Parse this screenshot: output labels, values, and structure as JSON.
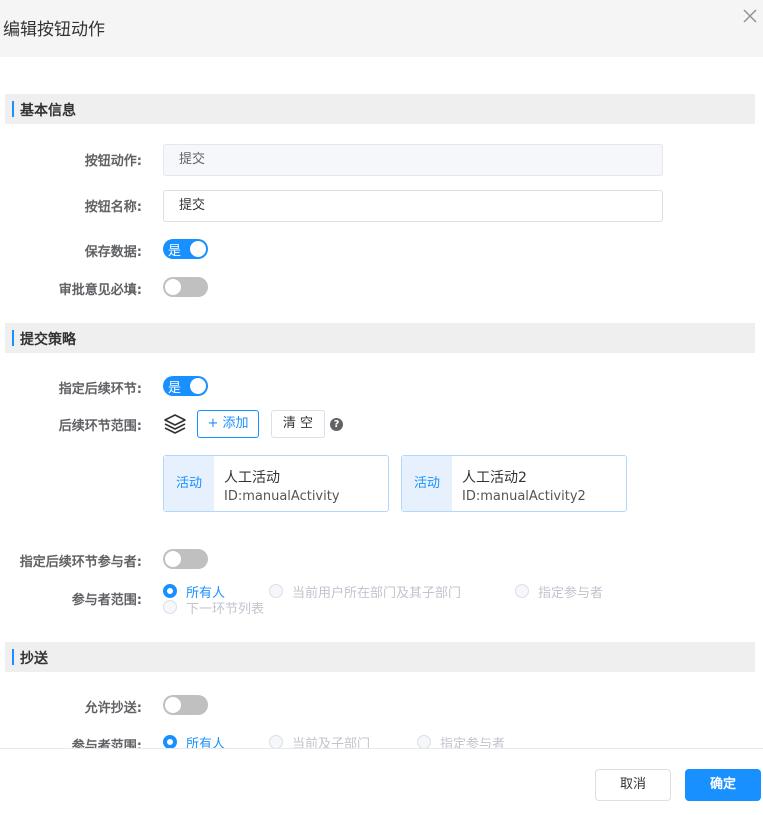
{
  "dialog": {
    "title": "编辑按钮动作"
  },
  "section_basic": {
    "title": "基本信息",
    "action_label": "按钮动作:",
    "action_value": "提交",
    "name_label": "按钮名称:",
    "name_value": "提交",
    "save_label": "保存数据:",
    "save_on": true,
    "save_text": "是",
    "opinion_label": "审批意见必填:",
    "opinion_on": false
  },
  "section_submit": {
    "title": "提交策略",
    "next_label": "指定后续环节:",
    "next_on": true,
    "next_text": "是",
    "range_label": "后续环节范围:",
    "add_button": "+ 添加",
    "clear_button": "清 空",
    "help_glyph": "?",
    "activities": [
      {
        "tag": "活动",
        "name": "人工活动",
        "id": "ID:manualActivity"
      },
      {
        "tag": "活动",
        "name": "人工活动2",
        "id": "ID:manualActivity2"
      }
    ],
    "participant_label": "指定后续环节参与者:",
    "participant_on": false,
    "scope_label": "参与者范围:",
    "scope_options": [
      "所有人",
      "当前用户所在部门及其子部门",
      "指定参与者",
      "下一环节列表"
    ],
    "scope_selected": "所有人"
  },
  "section_cc": {
    "title": "抄送",
    "allow_label": "允许抄送:",
    "allow_on": false,
    "scope_label": "参与者范围:",
    "scope_options": [
      "所有人",
      "当前及子部门",
      "指定参与者"
    ],
    "scope_selected": "所有人"
  },
  "footer": {
    "cancel": "取消",
    "confirm": "确定"
  },
  "colors": {
    "primary": "#1890ff",
    "section_bg": "#efefef",
    "switch_off": "#c0c0c0"
  },
  "icons": {
    "close": "close-icon",
    "layers": "layers-icon",
    "help": "help-icon"
  }
}
